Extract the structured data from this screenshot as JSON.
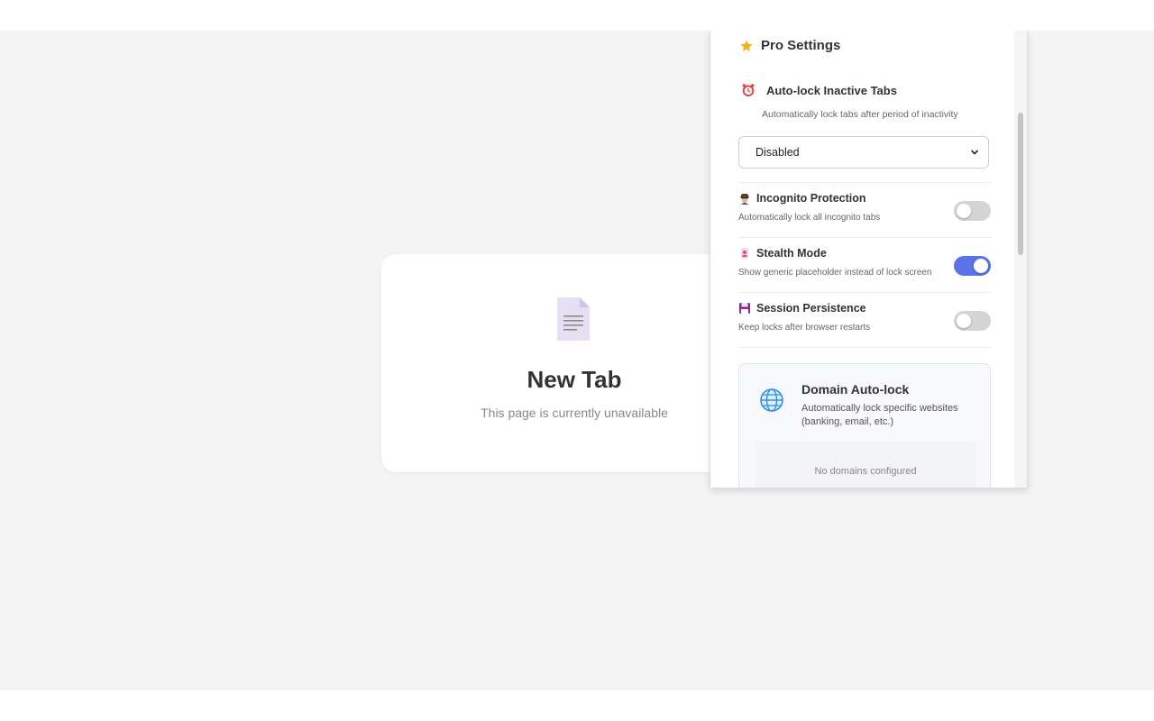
{
  "page": {
    "card_title": "New Tab",
    "card_subtitle": "This page is currently unavailable",
    "doc_icon": "document-icon"
  },
  "popup": {
    "pro_section": {
      "title": "Pro Settings",
      "icon": "star-icon"
    },
    "auto_lock": {
      "icon": "alarm-clock-icon",
      "title": "Auto-lock Inactive Tabs",
      "description": "Automatically lock tabs after period of inactivity",
      "selected": "Disabled"
    },
    "toggles": [
      {
        "icon": "spy-icon",
        "title": "Incognito Protection",
        "description": "Automatically lock all incognito tabs",
        "on": false
      },
      {
        "icon": "ghost-icon",
        "title": "Stealth Mode",
        "description": "Show generic placeholder instead of lock screen",
        "on": true
      },
      {
        "icon": "floppy-disk-icon",
        "title": "Session Persistence",
        "description": "Keep locks after browser restarts",
        "on": false
      }
    ],
    "domain_autolock": {
      "icon": "globe-icon",
      "title": "Domain Auto-lock",
      "description": "Automatically lock specific websites (banking, email, etc.)",
      "empty_text": "No domains configured"
    }
  },
  "colors": {
    "accent": "#5a73e6",
    "toggle_off": "#d4d4d4",
    "page_bg": "#f4f4f4"
  }
}
